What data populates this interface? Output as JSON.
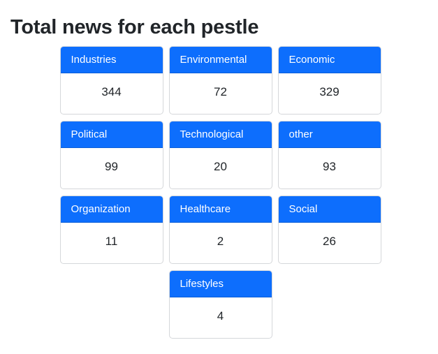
{
  "title": "Total news for each pestle",
  "cards": [
    {
      "label": "Industries",
      "count": "344"
    },
    {
      "label": "Environmental",
      "count": "72"
    },
    {
      "label": "Economic",
      "count": "329"
    },
    {
      "label": "Political",
      "count": "99"
    },
    {
      "label": "Technological",
      "count": "20"
    },
    {
      "label": "other",
      "count": "93"
    },
    {
      "label": "Organization",
      "count": "11"
    },
    {
      "label": "Healthcare",
      "count": "2"
    },
    {
      "label": "Social",
      "count": "26"
    },
    {
      "label": "Lifestyles",
      "count": "4"
    }
  ],
  "colors": {
    "header_bg": "#0d6efd",
    "header_text": "#ffffff",
    "body_text": "#212529",
    "card_border": "#d5d7da"
  }
}
